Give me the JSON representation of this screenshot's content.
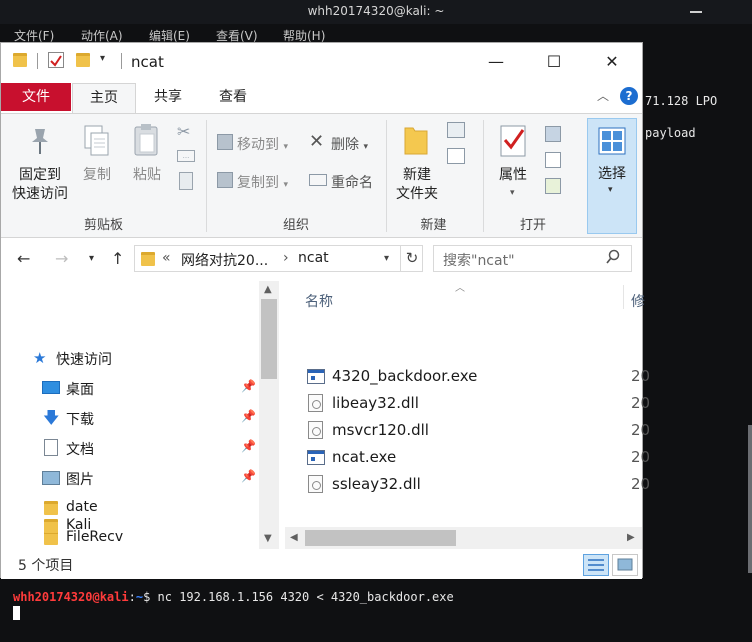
{
  "terminal": {
    "title": "whh20174320@kali: ~",
    "menu": [
      "文件(F)",
      "动作(A)",
      "编辑(E)",
      "查看(V)",
      "帮助(H)"
    ],
    "right_line1": "71.128 LPO",
    "right_line2": "payload",
    "prompt_user": "whh20174320@kali",
    "prompt_sep": ":",
    "prompt_path": "~",
    "prompt_dollar": "$",
    "command": " nc 192.168.1.156 4320 < 4320_backdoor.exe"
  },
  "explorer": {
    "window_title": "ncat",
    "controls": {
      "minimize": "—",
      "maximize": "☐",
      "close": "✕"
    },
    "ribbon_tabs": {
      "file": "文件",
      "home": "主页",
      "share": "共享",
      "view": "查看"
    },
    "ribbon": {
      "clipboard": {
        "group_label": "剪贴板",
        "pin": "固定到\n快速访问",
        "copy": "复制",
        "paste": "粘贴"
      },
      "organize": {
        "group_label": "组织",
        "move_to": "移动到",
        "copy_to": "复制到",
        "delete": "删除",
        "rename": "重命名"
      },
      "new": {
        "group_label": "新建",
        "new_folder": "新建\n文件夹"
      },
      "open": {
        "group_label": "打开",
        "properties": "属性"
      },
      "select": {
        "label": "选择"
      }
    },
    "address": {
      "prefix": "«",
      "crumb1": "网络对抗20...",
      "chevron": "›",
      "crumb2": "ncat",
      "search_placeholder": "搜索\"ncat\""
    },
    "nav": {
      "quick_access": "快速访问",
      "items": [
        {
          "label": "桌面",
          "pinned": true
        },
        {
          "label": "下载",
          "pinned": true
        },
        {
          "label": "文档",
          "pinned": true
        },
        {
          "label": "图片",
          "pinned": true
        },
        {
          "label": "date",
          "pinned": false
        },
        {
          "label": "FileRecv",
          "pinned": false
        },
        {
          "label": "Kali",
          "pinned": false
        }
      ]
    },
    "columns": {
      "name": "名称",
      "modified": "修"
    },
    "files": [
      {
        "name": "4320_backdoor.exe",
        "date": "20",
        "type": "exe"
      },
      {
        "name": "libeay32.dll",
        "date": "20",
        "type": "dll"
      },
      {
        "name": "msvcr120.dll",
        "date": "20",
        "type": "dll"
      },
      {
        "name": "ncat.exe",
        "date": "20",
        "type": "exe"
      },
      {
        "name": "ssleay32.dll",
        "date": "20",
        "type": "dll"
      }
    ],
    "status": "5 个项目"
  }
}
